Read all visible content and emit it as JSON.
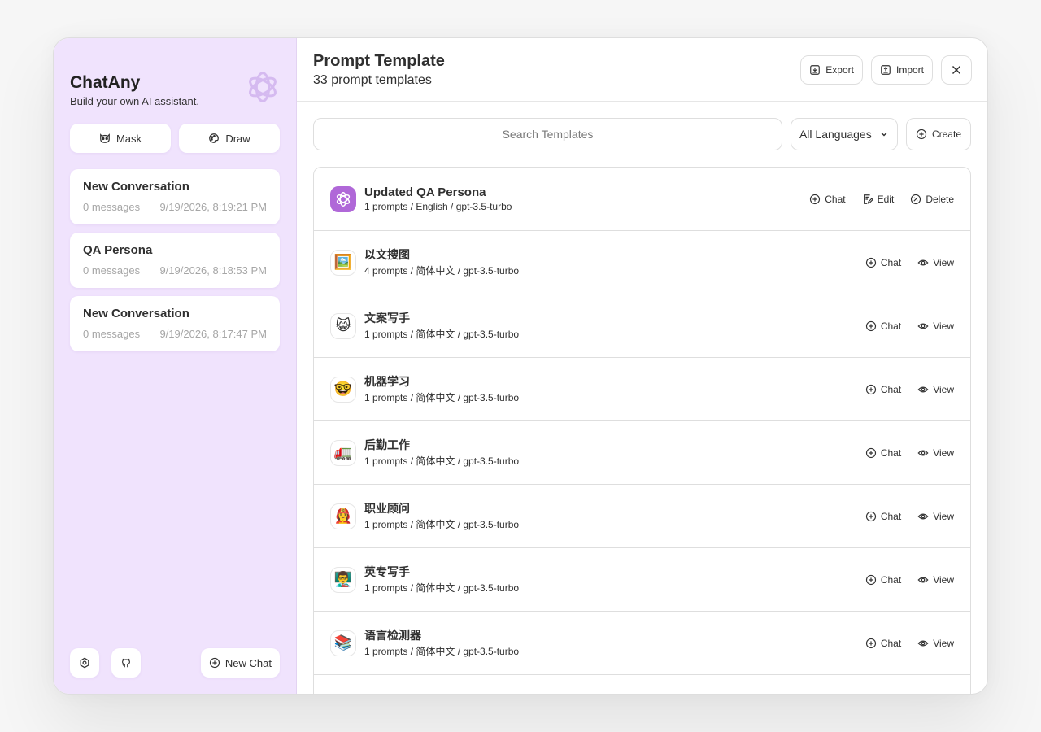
{
  "sidebar": {
    "title": "ChatAny",
    "subtitle": "Build your own AI assistant.",
    "mask_label": "Mask",
    "draw_label": "Draw",
    "conversations": [
      {
        "title": "New Conversation",
        "count": "0 messages",
        "time": "9/19/2026, 8:19:21 PM"
      },
      {
        "title": "QA Persona",
        "count": "0 messages",
        "time": "9/19/2026, 8:18:53 PM"
      },
      {
        "title": "New Conversation",
        "count": "0 messages",
        "time": "9/19/2026, 8:17:47 PM"
      }
    ],
    "new_chat_label": "New Chat"
  },
  "header": {
    "title": "Prompt Template",
    "subtitle": "33 prompt templates",
    "export_label": "Export",
    "import_label": "Import"
  },
  "toolbar": {
    "search_placeholder": "Search Templates",
    "language": "All Languages",
    "create_label": "Create"
  },
  "templates": [
    {
      "name": "Updated QA Persona",
      "meta": "1 prompts / English / gpt-3.5-turbo",
      "icon": "openai-logo",
      "actions": [
        "Chat",
        "Edit",
        "Delete"
      ]
    },
    {
      "name": "以文搜图",
      "meta": "4 prompts / 简体中文 / gpt-3.5-turbo",
      "icon": "🖼️",
      "actions": [
        "Chat",
        "View"
      ]
    },
    {
      "name": "文案写手",
      "meta": "1 prompts / 简体中文 / gpt-3.5-turbo",
      "icon": "😸",
      "actions": [
        "Chat",
        "View"
      ]
    },
    {
      "name": "机器学习",
      "meta": "1 prompts / 简体中文 / gpt-3.5-turbo",
      "icon": "🤓",
      "actions": [
        "Chat",
        "View"
      ]
    },
    {
      "name": "后勤工作",
      "meta": "1 prompts / 简体中文 / gpt-3.5-turbo",
      "icon": "🚛",
      "actions": [
        "Chat",
        "View"
      ]
    },
    {
      "name": "职业顾问",
      "meta": "1 prompts / 简体中文 / gpt-3.5-turbo",
      "icon": "👩‍🚒",
      "actions": [
        "Chat",
        "View"
      ]
    },
    {
      "name": "英专写手",
      "meta": "1 prompts / 简体中文 / gpt-3.5-turbo",
      "icon": "👨‍🏫",
      "actions": [
        "Chat",
        "View"
      ]
    },
    {
      "name": "语言检测器",
      "meta": "1 prompts / 简体中文 / gpt-3.5-turbo",
      "icon": "📚",
      "actions": [
        "Chat",
        "View"
      ]
    }
  ],
  "colors": {
    "sidebar_bg": "#f0e3fd",
    "accent": "#b068d8"
  }
}
